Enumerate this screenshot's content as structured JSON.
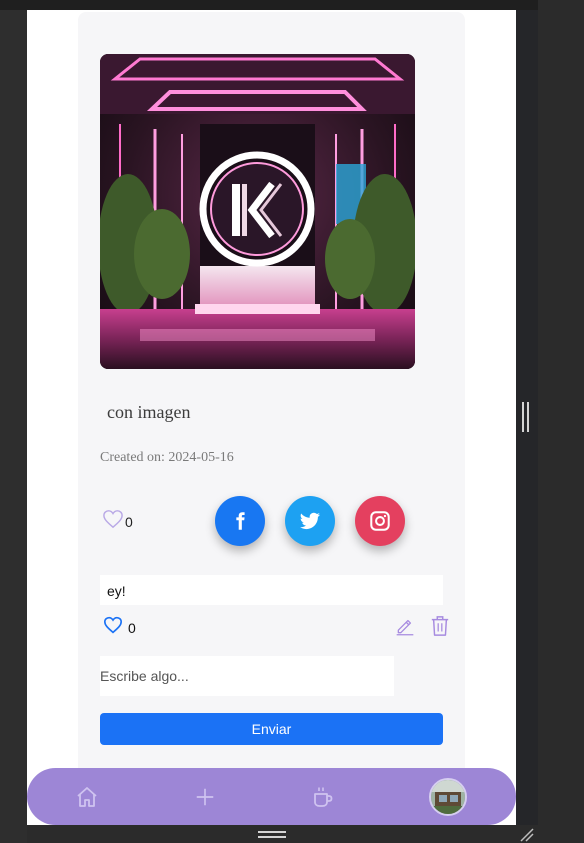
{
  "post": {
    "title": "con imagen",
    "created_label": "Created on:",
    "created_date": "2024-05-16",
    "like_count": "0",
    "image_icon": "neon-k-logo-image"
  },
  "share": {
    "facebook_icon": "facebook-icon",
    "twitter_icon": "twitter-icon",
    "instagram_icon": "instagram-icon"
  },
  "comment": {
    "text": "ey!",
    "like_count": "0"
  },
  "form": {
    "placeholder": "Escribe algo...",
    "send_label": "Enviar"
  },
  "nav": {
    "items": [
      "home-icon",
      "plus-icon",
      "coffee-icon",
      "avatar"
    ]
  },
  "colors": {
    "accent": "#9d86d6",
    "primary_button": "#1b72f5",
    "facebook": "#1877f2",
    "twitter": "#1da1f2",
    "instagram": "#e4405f"
  }
}
